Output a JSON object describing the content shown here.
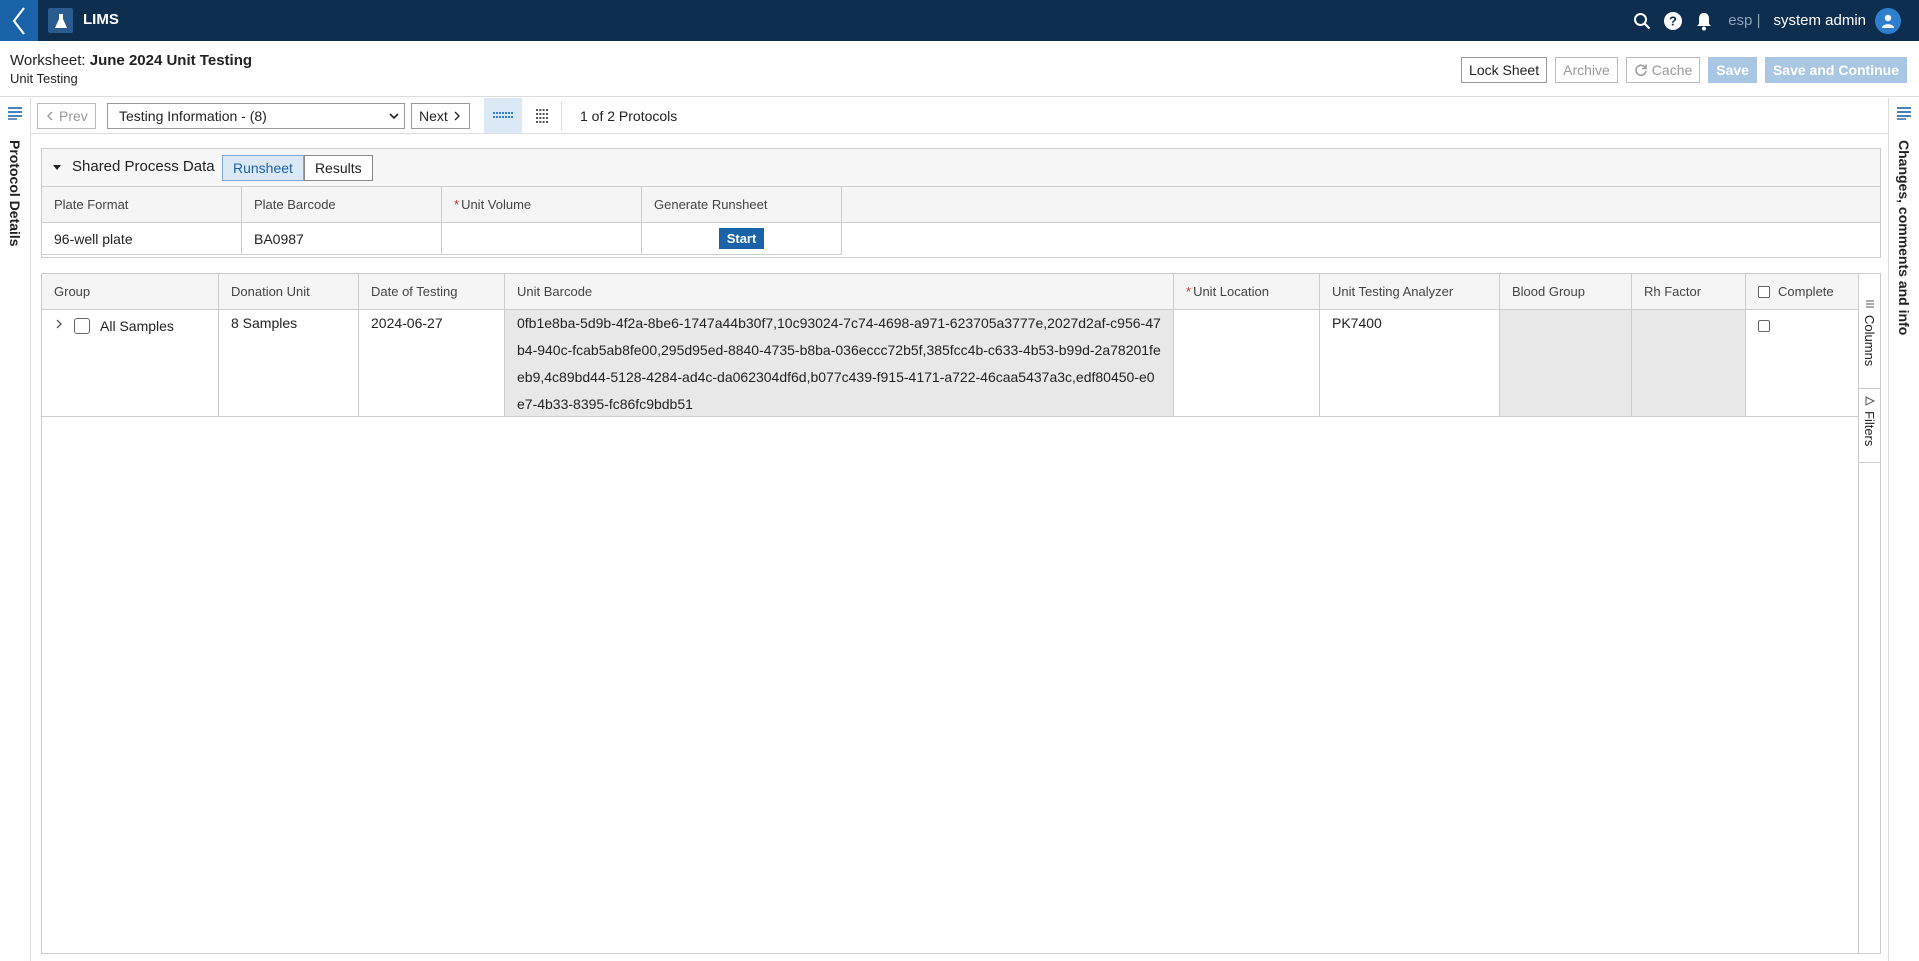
{
  "app": {
    "title": "LIMS"
  },
  "topbar": {
    "tenant": "esp |",
    "user": "system admin"
  },
  "worksheet": {
    "label": "Worksheet:",
    "name": "June 2024 Unit Testing",
    "subtitle": "Unit Testing"
  },
  "header_actions": {
    "lock_sheet": "Lock Sheet",
    "archive": "Archive",
    "cache": "Cache",
    "save": "Save",
    "save_continue": "Save and Continue"
  },
  "rails": {
    "left": "Protocol Details",
    "right": "Changes, comments and info"
  },
  "nav": {
    "prev": "Prev",
    "protocol_selected": "Testing Information - (8)",
    "next": "Next",
    "count": "1 of 2 Protocols"
  },
  "shared_process": {
    "title": "Shared Process Data",
    "tabs": [
      "Runsheet",
      "Results"
    ],
    "columns": [
      "Plate Format",
      "Plate Barcode",
      "Unit Volume",
      "Generate Runsheet"
    ],
    "row": {
      "plate_format": "96-well plate",
      "plate_barcode": "BA0987",
      "unit_volume": "",
      "start": "Start"
    }
  },
  "grid": {
    "columns": [
      "Group",
      "Donation Unit",
      "Date of Testing",
      "Unit Barcode",
      "Unit Location",
      "Unit Testing Analyzer",
      "Blood Group",
      "Rh Factor",
      "Complete"
    ],
    "row": {
      "group": "All Samples",
      "donation_unit": "8 Samples",
      "date": "2024-06-27",
      "barcode": "0fb1e8ba-5d9b-4f2a-8be6-1747a44b30f7,10c93024-7c74-4698-a971-623705a3777e,2027d2af-c956-47b4-940c-fcab5ab8fe00,295d95ed-8840-4735-b8ba-036eccc72b5f,385fcc4b-c633-4b53-b99d-2a78201feeb9,4c89bd44-5128-4284-ad4c-da062304df6d,b077c439-f915-4171-a722-46caa5437a3c,edf80450-e0e7-4b33-8395-fc86fc9bdb51",
      "location": "",
      "analyzer": "PK7400",
      "blood_group": "",
      "rh_factor": ""
    },
    "side_tools": [
      "Columns",
      "Filters"
    ]
  },
  "colors": {
    "topbar": "#0e2e4f",
    "accent": "#1a63a8",
    "primary_disabled": "#a9c6e3"
  }
}
